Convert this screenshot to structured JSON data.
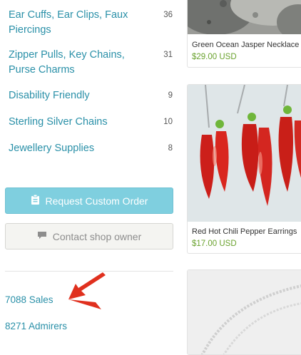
{
  "categories": [
    {
      "label": "Ear Cuffs, Ear Clips, Faux Piercings",
      "count": "36"
    },
    {
      "label": "Zipper Pulls, Key Chains, Purse Charms",
      "count": "31"
    },
    {
      "label": "Disability Friendly",
      "count": "9"
    },
    {
      "label": "Sterling Silver Chains",
      "count": "10"
    },
    {
      "label": "Jewellery Supplies",
      "count": "8"
    }
  ],
  "buttons": {
    "request_custom_order": "Request Custom Order",
    "contact_shop_owner": "Contact shop owner"
  },
  "stats": {
    "sales": "7088 Sales",
    "admirers": "8271 Admirers"
  },
  "listings": [
    {
      "title": "Green Ocean Jasper Necklace",
      "price": "$29.00 USD"
    },
    {
      "title": "Red Hot Chili Pepper Earrings",
      "price": "$17.00 USD"
    }
  ],
  "colors": {
    "link": "#2a90a8",
    "request_button": "#7fcfdf",
    "price": "#6aa22e",
    "arrow": "#e0301e"
  },
  "icons": [
    "clipboard-icon",
    "speech-bubble-icon",
    "red-arrow-annotation"
  ]
}
